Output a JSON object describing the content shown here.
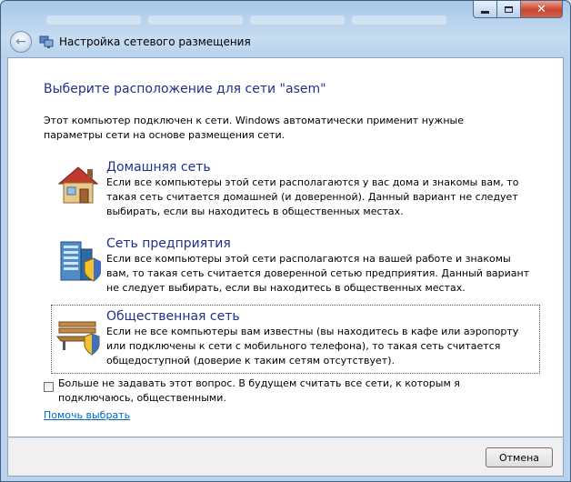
{
  "window": {
    "title": "Настройка сетевого размещения",
    "close_glyph": "✕",
    "back_glyph": "←"
  },
  "main": {
    "heading": "Выберите расположение для сети \"asem\"",
    "intro": "Этот компьютер подключен к сети. Windows автоматически применит нужные параметры сети на основе размещения сети.",
    "options": [
      {
        "title": "Домашняя сеть",
        "description": "Если все компьютеры этой сети располагаются у вас дома и знакомы вам, то такая сеть считается домашней (и доверенной). Данный вариант не следует выбирать, если вы находитесь в общественных местах.",
        "icon": "house-icon"
      },
      {
        "title": "Сеть предприятия",
        "description": "Если все компьютеры этой сети располагаются на вашей работе и знакомы вам, то такая сеть считается доверенной сетью предприятия. Данный вариант не следует выбирать, если вы находитесь в общественных местах.",
        "icon": "office-building-icon"
      },
      {
        "title": "Общественная сеть",
        "description": "Если не все компьютеры вам известны (вы находитесь в кафе или аэропорту или подключены к сети с мобильного телефона), то такая сеть считается общедоступной (доверие к таким сетям отсутствует).",
        "icon": "park-bench-icon"
      }
    ],
    "checkbox_label": "Больше не задавать этот вопрос. В будущем считать все сети, к которым я подключаюсь, общественными.",
    "checkbox_checked": false,
    "help_link": "Помочь выбрать"
  },
  "footer": {
    "cancel_label": "Отмена"
  },
  "colors": {
    "heading": "#1e3287",
    "link": "#0066cc",
    "close_button": "#c8452e"
  }
}
